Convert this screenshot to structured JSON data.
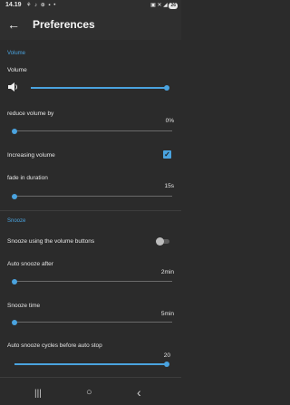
{
  "status_bar": {
    "time": "14.19",
    "left_icons": "⚘ ♪ ⊕ ▪ •",
    "right_icons": "▣ ✕ ◢",
    "battery": "26"
  },
  "app_bar": {
    "title": "Preferences",
    "back_icon": "arrow-left-icon"
  },
  "volume_section": {
    "header": "Volume",
    "volume_label": "Volume",
    "volume_level": 1.0,
    "reduce_label": "reduce volume by",
    "reduce_value": "0%",
    "reduce_level": 0.0,
    "increasing_label": "Increasing volume",
    "increasing_checked": true,
    "fade_label": "fade in duration",
    "fade_value": "15s",
    "fade_level": 0.0
  },
  "snooze_section": {
    "header": "Snooze",
    "snooze_buttons_label": "Snooze using the volume buttons",
    "snooze_buttons_on": false,
    "auto_snooze_label": "Auto snooze after",
    "auto_snooze_value": "2min",
    "auto_snooze_level": 0.0,
    "snooze_time_label": "Snooze time",
    "snooze_time_value": "5min",
    "snooze_time_level": 0.0,
    "cycles_label": "Auto snooze cycles before auto stop",
    "cycles_value": "20",
    "cycles_level": 1.0
  },
  "nav_bar": {
    "recents": "|||",
    "home": "○",
    "back": "‹"
  },
  "colors": {
    "accent": "#4aa3df",
    "background": "#2b2b2b"
  }
}
